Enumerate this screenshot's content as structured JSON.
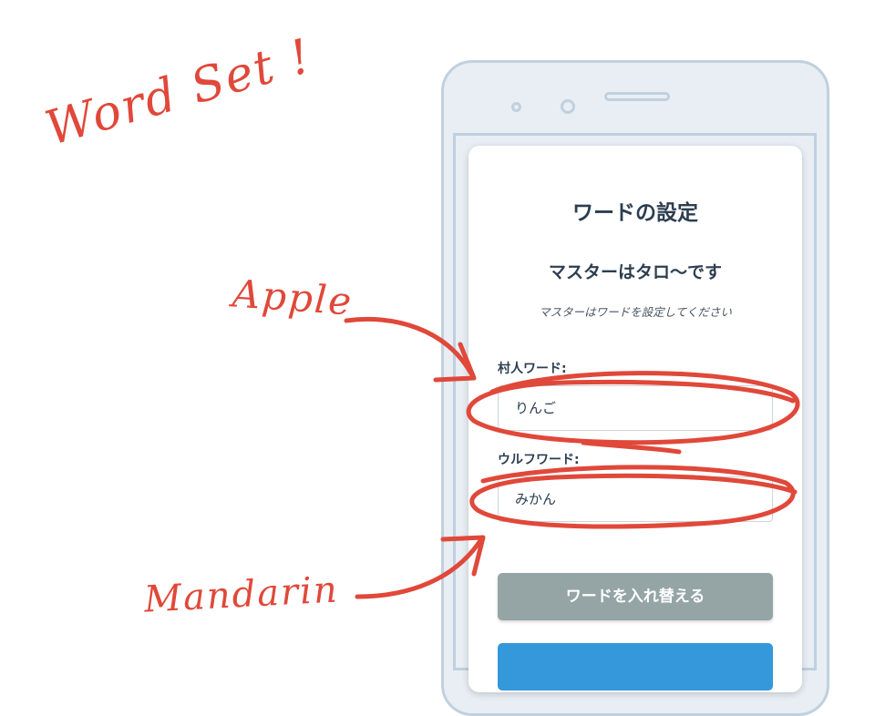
{
  "annotations": {
    "title": "Word Set !",
    "apple": "Apple",
    "mandarin": "Mandarin"
  },
  "card": {
    "title": "ワードの設定",
    "master_line": "マスターはタロ〜です",
    "instruction": "マスターはワードを設定してください",
    "villager_label": "村人ワード:",
    "villager_value": "りんご",
    "wolf_label": "ウルフワード:",
    "wolf_value": "みかん",
    "swap_button": "ワードを入れ替える"
  },
  "colors": {
    "annotation_red": "#e0483a",
    "swap_button_bg": "#95a5a6",
    "primary_button_bg": "#3498db",
    "heading_text": "#2c3e50"
  }
}
